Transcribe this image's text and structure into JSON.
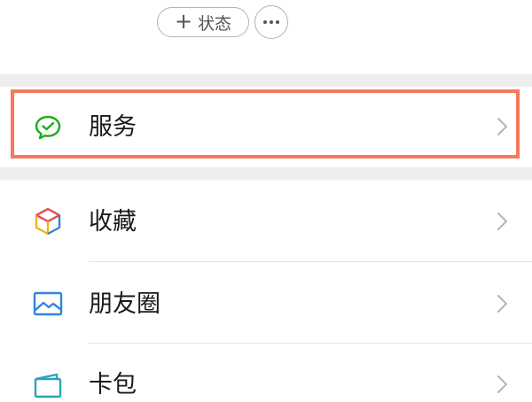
{
  "header": {
    "status_button_label": "状态",
    "status_plus_icon": "plus-icon",
    "more_icon": "more-icon"
  },
  "menu": {
    "items": [
      {
        "label": "服务",
        "icon": "wechat-pay-icon",
        "highlighted": true
      },
      {
        "label": "收藏",
        "icon": "favorites-cube-icon"
      },
      {
        "label": "朋友圈",
        "icon": "moments-image-icon"
      },
      {
        "label": "卡包",
        "icon": "card-wallet-icon"
      }
    ]
  },
  "colors": {
    "highlight_border": "#f47a5a",
    "services_icon": "#1aad19",
    "moments_icon": "#2e86de",
    "cards_icon": "#2aa5b8",
    "divider_gap": "#ededed"
  }
}
